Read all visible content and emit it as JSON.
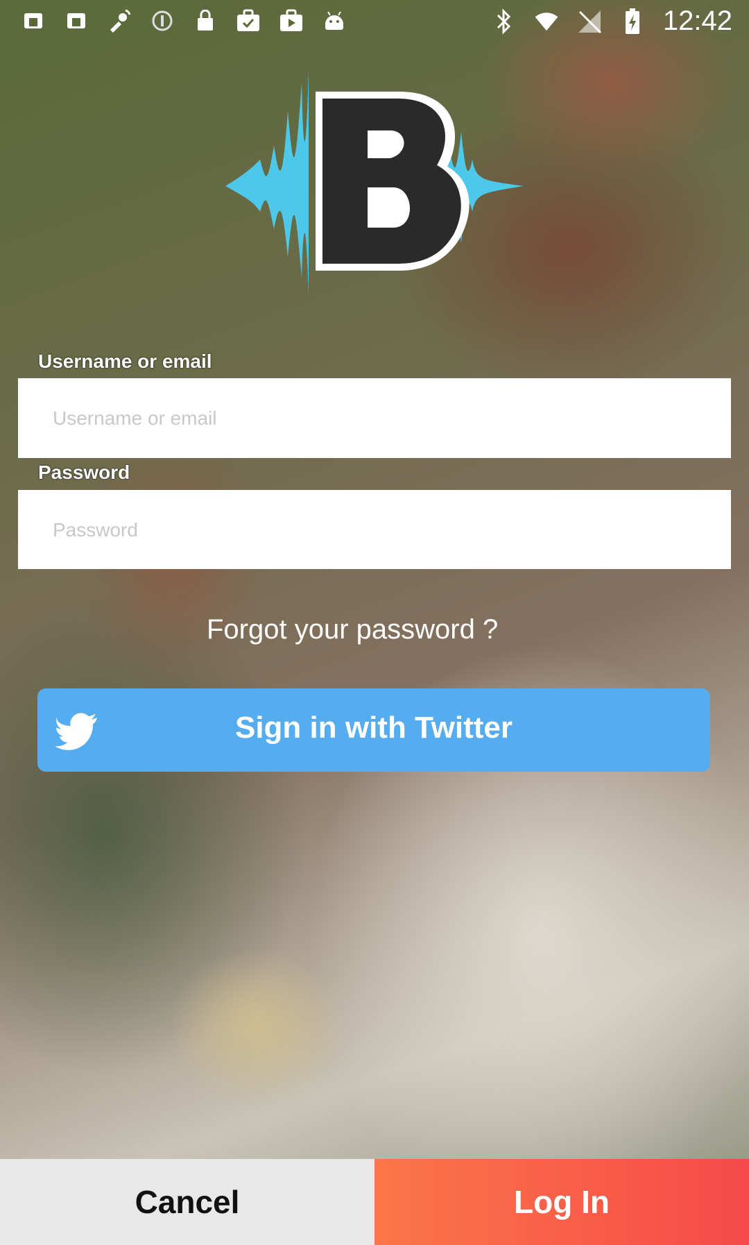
{
  "status_bar": {
    "time": "12:42",
    "left_icons": [
      "notification-icon",
      "notification-icon",
      "satellite-icon",
      "circle-icon",
      "lock-icon",
      "briefcase-check-icon",
      "youtube-icon",
      "android-icon"
    ],
    "right_icons": [
      "bluetooth-icon",
      "wifi-icon",
      "no-signal-icon",
      "battery-charging-icon"
    ]
  },
  "logo": {
    "letter": "B",
    "wave_color": "#4dc8e8"
  },
  "form": {
    "username_label": "Username or email",
    "username_placeholder": "Username or email",
    "password_label": "Password",
    "password_placeholder": "Password",
    "forgot": "Forgot your password ?"
  },
  "twitter": {
    "label": "Sign in with Twitter",
    "color": "#55acee"
  },
  "footer": {
    "cancel": "Cancel",
    "login": "Log In"
  }
}
